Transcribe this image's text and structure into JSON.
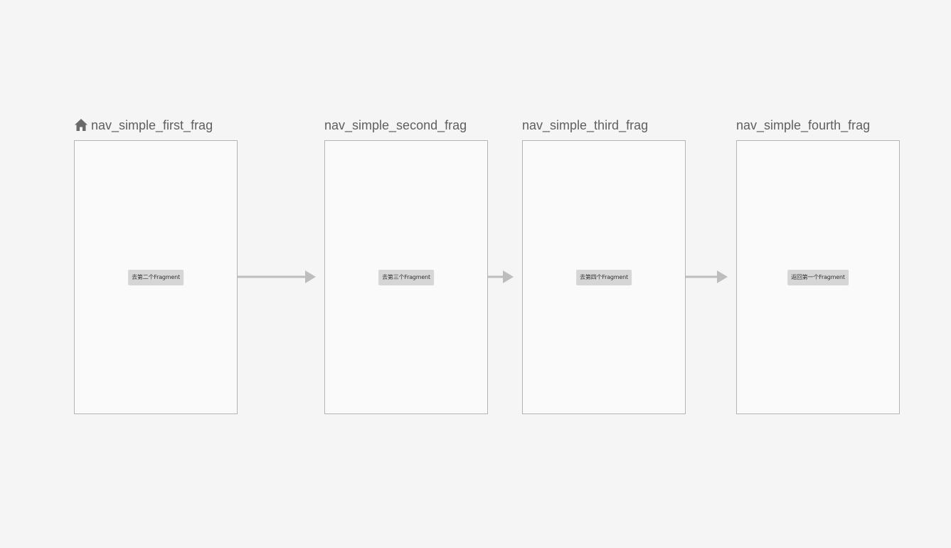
{
  "graph": {
    "destinations": [
      {
        "name": "nav_simple_first_frag",
        "is_start": true,
        "button_label": "去第二个Fragment"
      },
      {
        "name": "nav_simple_second_frag",
        "is_start": false,
        "button_label": "去第三个Fragment"
      },
      {
        "name": "nav_simple_third_frag",
        "is_start": false,
        "button_label": "去第四个Fragment"
      },
      {
        "name": "nav_simple_fourth_frag",
        "is_start": false,
        "button_label": "返回第一个Fragment"
      }
    ],
    "start_icon": "home-icon",
    "colors": {
      "background": "#f5f5f5",
      "frame_fill": "#fafafa",
      "frame_border": "#b4b4b4",
      "arrow": "#bdbdbd",
      "title_text": "#5f5f5f",
      "button_fill": "#d6d6d6"
    }
  }
}
